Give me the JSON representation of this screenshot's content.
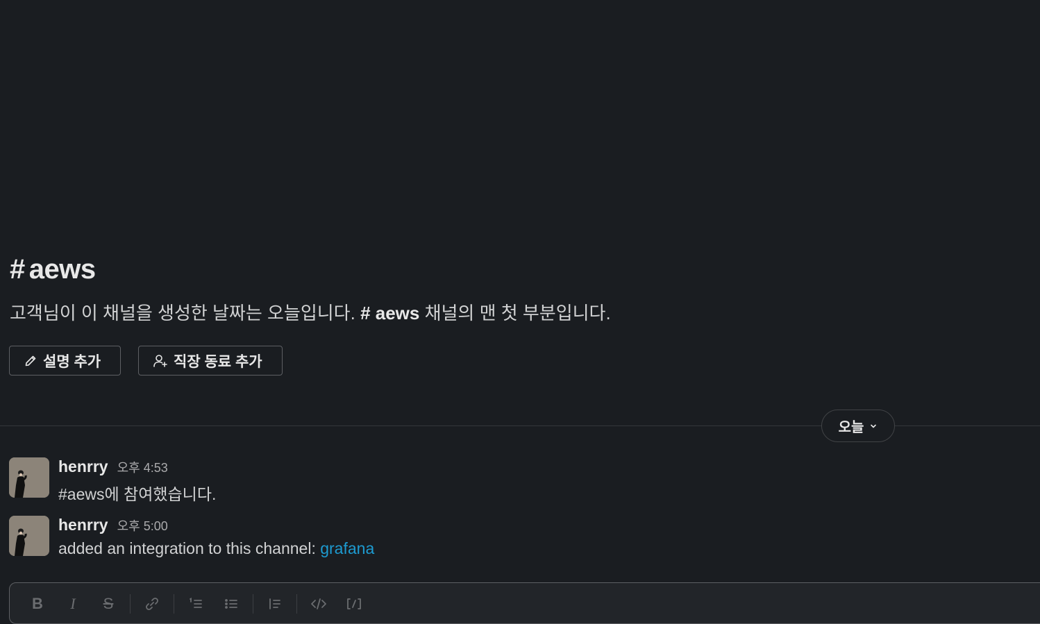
{
  "channel": {
    "hash": "#",
    "name": "aews",
    "intro_prefix": "고객님이 이 채널을 생성한 날짜는 오늘입니다.",
    "intro_channel": "# aews",
    "intro_suffix": "채널의 맨 첫 부분입니다."
  },
  "actions": {
    "add_description": "설명 추가",
    "add_coworkers": "직장 동료 추가"
  },
  "date_divider": {
    "label": "오늘"
  },
  "messages": [
    {
      "author": "henrry",
      "time": "오후 4:53",
      "text": "#aews에 참여했습니다."
    },
    {
      "author": "henrry",
      "time": "오후 5:00",
      "text_prefix": "added an integration to this channel: ",
      "link": "grafana"
    }
  ],
  "composer": {
    "toolbar": {
      "bold": "B",
      "italic": "I",
      "strike": "S",
      "icons": [
        "link-icon",
        "ordered-list-icon",
        "bulleted-list-icon",
        "blockquote-icon",
        "code-icon",
        "code-block-icon"
      ]
    }
  },
  "colors": {
    "background": "#1a1d21",
    "link": "#1d9bd1",
    "border": "#5e6064"
  }
}
